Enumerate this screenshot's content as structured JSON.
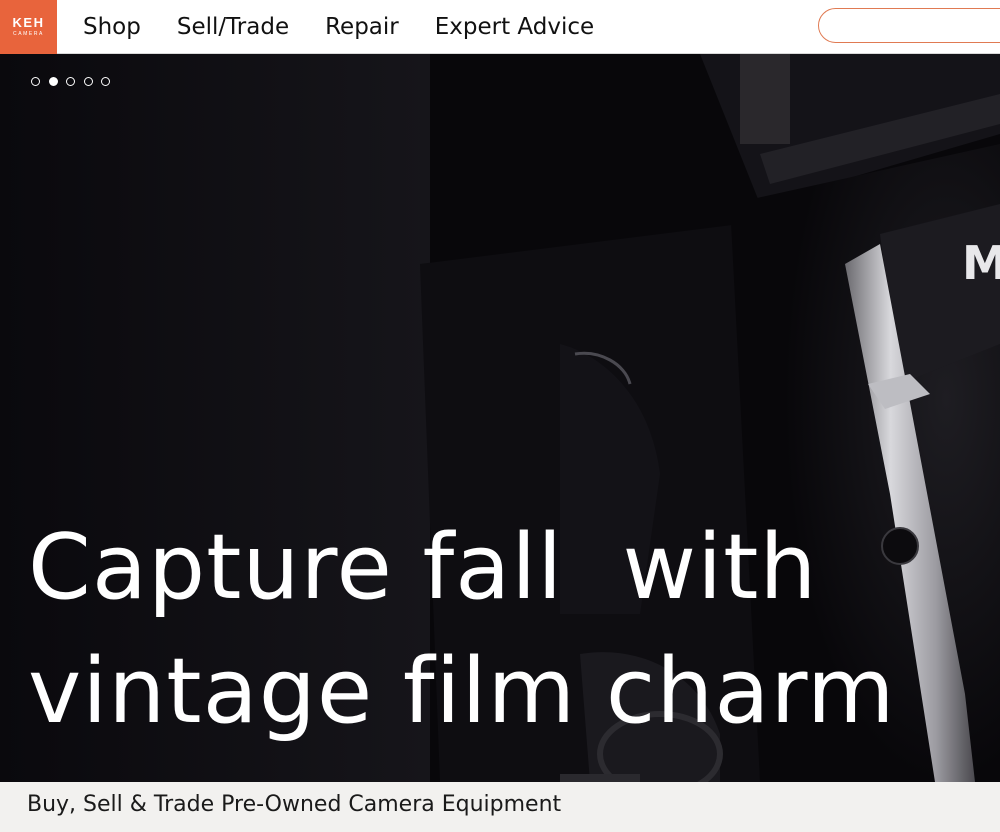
{
  "brand": {
    "logo_text": "KEH",
    "logo_subtext": "CAMERA",
    "accent_color": "#e8643c"
  },
  "nav": {
    "items": [
      {
        "label": "Shop"
      },
      {
        "label": "Sell/Trade"
      },
      {
        "label": "Repair"
      },
      {
        "label": "Expert Advice"
      }
    ]
  },
  "search": {
    "value": "",
    "placeholder": "",
    "icon": "search-field"
  },
  "hero": {
    "carousel": {
      "total_slides": 5,
      "active_slide": 2
    },
    "headline_line1": "Capture fall  with",
    "headline_line2": "vintage film charm",
    "background_subject": "camera-closeup"
  },
  "tagline": {
    "text": "Buy, Sell & Trade Pre-Owned Camera Equipment"
  }
}
